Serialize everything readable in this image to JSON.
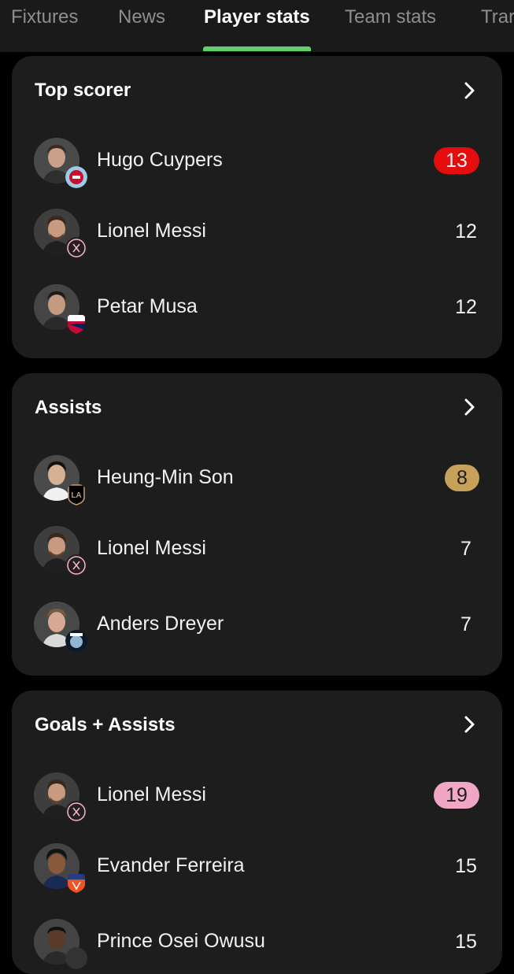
{
  "tabs": [
    {
      "label": "Fixtures",
      "active": false
    },
    {
      "label": "News",
      "active": false
    },
    {
      "label": "Player stats",
      "active": true
    },
    {
      "label": "Team stats",
      "active": false
    },
    {
      "label": "Trar",
      "active": false
    }
  ],
  "colors": {
    "accent_tab": "#5fd06b",
    "top_scorer_badge": "#e50d0d",
    "assists_badge": "#c7a15a",
    "ga_badge": "#f2a6c6"
  },
  "cards": [
    {
      "title": "Top scorer",
      "rows": [
        {
          "name": "Hugo Cuypers",
          "value": "13",
          "club_icon": "chicago-fire-crest-icon"
        },
        {
          "name": "Lionel Messi",
          "value": "12",
          "club_icon": "inter-miami-crest-icon"
        },
        {
          "name": "Petar Musa",
          "value": "12",
          "club_icon": "fc-dallas-crest-icon"
        }
      ]
    },
    {
      "title": "Assists",
      "rows": [
        {
          "name": "Heung-Min Son",
          "value": "8",
          "club_icon": "lafc-crest-icon"
        },
        {
          "name": "Lionel Messi",
          "value": "7",
          "club_icon": "inter-miami-crest-icon"
        },
        {
          "name": "Anders Dreyer",
          "value": "7",
          "club_icon": "san-diego-fc-crest-icon"
        }
      ]
    },
    {
      "title": "Goals + Assists",
      "rows": [
        {
          "name": "Lionel Messi",
          "value": "19",
          "club_icon": "inter-miami-crest-icon"
        },
        {
          "name": "Evander Ferreira",
          "value": "15",
          "club_icon": "fc-cincinnati-crest-icon"
        },
        {
          "name": "Prince Osei Owusu",
          "value": "15",
          "club_icon": "club-crest-icon"
        }
      ]
    }
  ]
}
